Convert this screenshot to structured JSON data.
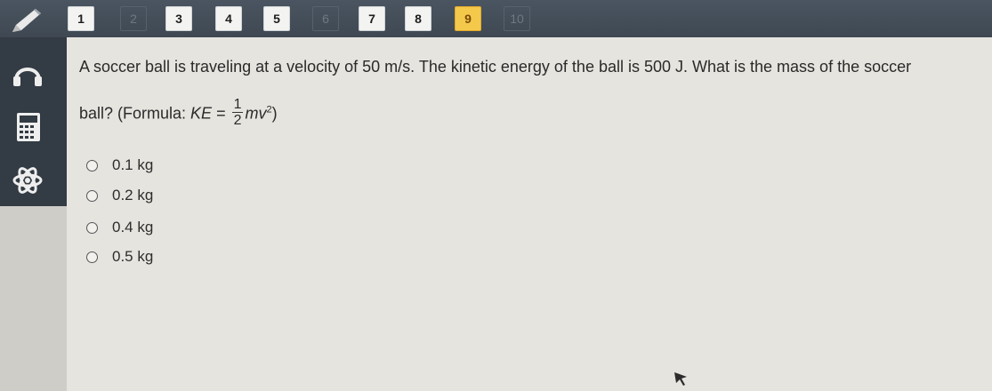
{
  "nav": {
    "questions": [
      {
        "label": "1",
        "state": "answered"
      },
      {
        "label": "2",
        "state": "unanswered"
      },
      {
        "label": "3",
        "state": "answered"
      },
      {
        "label": "4",
        "state": "answered"
      },
      {
        "label": "5",
        "state": "answered"
      },
      {
        "label": "6",
        "state": "unanswered"
      },
      {
        "label": "7",
        "state": "answered"
      },
      {
        "label": "8",
        "state": "answered"
      },
      {
        "label": "9",
        "state": "current"
      },
      {
        "label": "10",
        "state": "unanswered"
      }
    ]
  },
  "tools": [
    "pencil-icon",
    "headphones-icon",
    "calculator-icon",
    "atom-icon"
  ],
  "question": {
    "line1": "A soccer ball is traveling at a velocity of 50 m/s. The kinetic energy of the ball is 500 J. What is the mass of the soccer",
    "line2_prefix": "ball? (Formula: ",
    "formula_lhs": "KE",
    "formula_eq": " = ",
    "frac_num": "1",
    "frac_den": "2",
    "formula_m": "m",
    "formula_v": "v",
    "formula_exp": "2",
    "line2_suffix": ")"
  },
  "options": [
    {
      "label": "0.1 kg"
    },
    {
      "label": "0.2 kg"
    },
    {
      "label": "0.4 kg"
    },
    {
      "label": "0.5 kg"
    }
  ],
  "colors": {
    "topbar": "#434d57",
    "current_question": "#f4c84b",
    "sidebar": "#333b44",
    "background": "#e6e4df"
  }
}
